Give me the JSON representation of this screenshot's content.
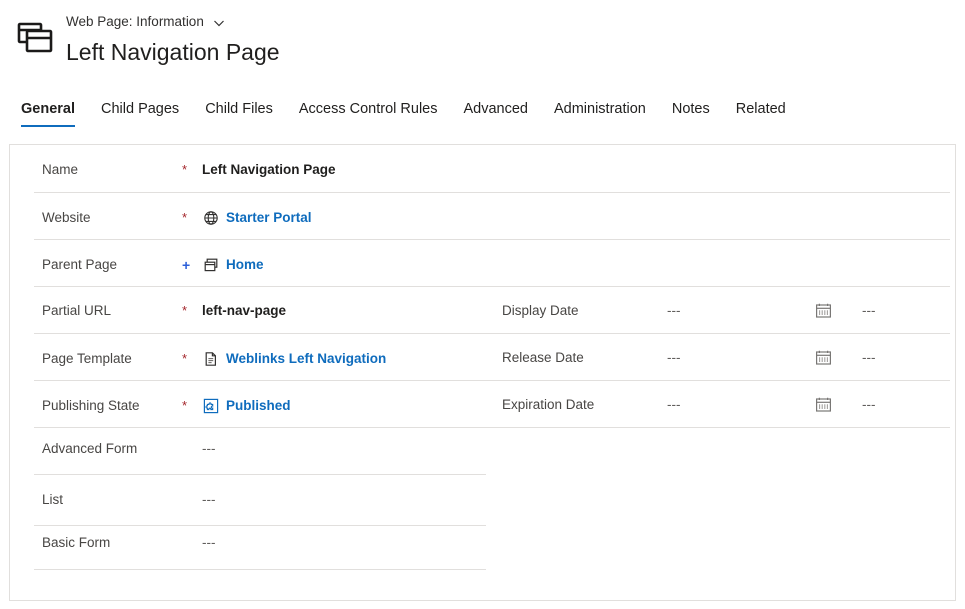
{
  "header": {
    "entity_label": "Web Page: Information",
    "record_title": "Left Navigation Page",
    "entity_icon": "web-pages-icon",
    "chevron_icon": "chevron-down-icon"
  },
  "tabs": [
    {
      "label": "General",
      "active": true
    },
    {
      "label": "Child Pages",
      "active": false
    },
    {
      "label": "Child Files",
      "active": false
    },
    {
      "label": "Access Control Rules",
      "active": false
    },
    {
      "label": "Advanced",
      "active": false
    },
    {
      "label": "Administration",
      "active": false
    },
    {
      "label": "Notes",
      "active": false
    },
    {
      "label": "Related",
      "active": false
    }
  ],
  "form": {
    "left_fields": [
      {
        "label": "Name",
        "required_marker": "*",
        "required_color": "red",
        "value": "Left Navigation Page",
        "value_type": "text",
        "icon": null
      },
      {
        "label": "Website",
        "required_marker": "*",
        "required_color": "red",
        "value": "Starter Portal",
        "value_type": "link",
        "icon": "globe-icon"
      },
      {
        "label": "Parent Page",
        "required_marker": "+",
        "required_color": "blue",
        "value": "Home",
        "value_type": "link",
        "icon": "web-pages-icon"
      },
      {
        "label": "Partial URL",
        "required_marker": "*",
        "required_color": "red",
        "value": "left-nav-page",
        "value_type": "text",
        "icon": null
      },
      {
        "label": "Page Template",
        "required_marker": "*",
        "required_color": "red",
        "value": "Weblinks Left Navigation",
        "value_type": "link",
        "icon": "document-icon"
      },
      {
        "label": "Publishing State",
        "required_marker": "*",
        "required_color": "red",
        "value": "Published",
        "value_type": "link",
        "icon": "puzzle-icon"
      },
      {
        "label": "Advanced Form",
        "required_marker": "",
        "required_color": "none",
        "value": "---",
        "value_type": "empty",
        "icon": null
      },
      {
        "label": "List",
        "required_marker": "",
        "required_color": "none",
        "value": "---",
        "value_type": "empty",
        "icon": null
      },
      {
        "label": "Basic Form",
        "required_marker": "",
        "required_color": "none",
        "value": "---",
        "value_type": "empty",
        "icon": null
      }
    ],
    "date_fields": [
      {
        "label": "Display Date",
        "date_value": "---",
        "time_value": "---",
        "date_icon": "calendar-icon",
        "time_icon": "clock-icon"
      },
      {
        "label": "Release Date",
        "date_value": "---",
        "time_value": "---",
        "date_icon": "calendar-icon",
        "time_icon": "clock-icon"
      },
      {
        "label": "Expiration Date",
        "date_value": "---",
        "time_value": "---",
        "date_icon": "calendar-icon",
        "time_icon": "clock-icon"
      }
    ]
  },
  "colors": {
    "link_blue": "#0f6cbd",
    "required_red": "#a4262c",
    "required_blue": "#2b5fd9",
    "divider": "#e1dfdd",
    "icon_gray": "#797775"
  }
}
